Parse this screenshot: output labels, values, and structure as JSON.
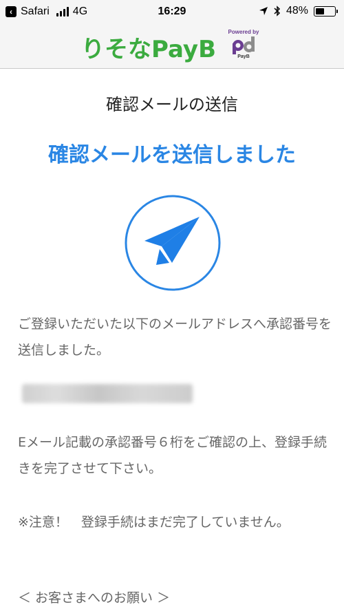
{
  "status_bar": {
    "back_app": "Safari",
    "network": "4G",
    "time": "16:29",
    "battery_percent": "48%",
    "battery_level": 0.48
  },
  "header": {
    "brand": "りそなPayB",
    "powered_by": "Powered by",
    "payb_small": "PayB"
  },
  "main": {
    "page_title": "確認メールの送信",
    "headline": "確認メールを送信しました",
    "message_1": "ご登録いただいた以下のメールアドレスへ承認番号を送信しました。",
    "message_2": "Eメール記載の承認番号６桁をご確認の上、登録手続きを完了させて下さい。",
    "message_3": "※注意！　登録手続はまだ完了していません。",
    "request_link": "＜ お客さまへのお願い ＞"
  },
  "colors": {
    "brand_green": "#3bab3f",
    "accent_blue": "#2a86e4",
    "powered_purple": "#6a3d91"
  }
}
